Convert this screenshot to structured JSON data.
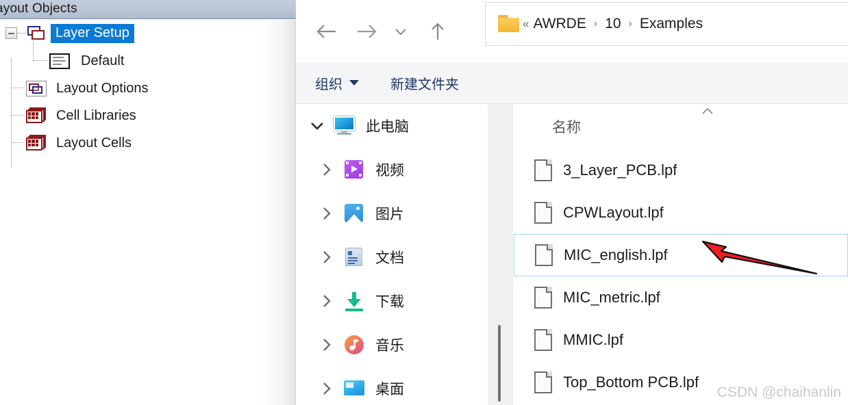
{
  "left_panel": {
    "title": "ayout Objects",
    "tree": [
      {
        "label": "Layer Setup",
        "icon": "layer-setup-icon",
        "selected": true,
        "level": 0,
        "expander": "collapse"
      },
      {
        "label": "Default",
        "icon": "default-layer-icon",
        "selected": false,
        "level": 1
      },
      {
        "label": "Layout Options",
        "icon": "layout-options-icon",
        "selected": false,
        "level": 0
      },
      {
        "label": "Cell Libraries",
        "icon": "cell-libraries-icon",
        "selected": false,
        "level": 0
      },
      {
        "label": "Layout Cells",
        "icon": "layout-cells-icon",
        "selected": false,
        "level": 0
      }
    ],
    "colors": {
      "titlebar": "#b9c6d6",
      "selection": "#0b7ad4",
      "icon_red": "#8b1a1a",
      "icon_blue": "#1b2a80"
    }
  },
  "explorer": {
    "nav": {
      "back": "←",
      "forward": "→",
      "recent": "⌄",
      "up": "↑"
    },
    "address": {
      "folder_icon": "folder-icon",
      "overflow": "«",
      "crumbs": [
        "AWRDE",
        "10",
        "Examples"
      ],
      "separator": "›"
    },
    "command_bar": {
      "organize": "组织",
      "new_folder": "新建文件夹"
    },
    "nav_pane": [
      {
        "label": "此电脑",
        "icon": "this-pc-icon",
        "expanded": true,
        "level": 0
      },
      {
        "label": "视频",
        "icon": "videos-icon",
        "expanded": false,
        "level": 1
      },
      {
        "label": "图片",
        "icon": "pictures-icon",
        "expanded": false,
        "level": 1
      },
      {
        "label": "文档",
        "icon": "documents-icon",
        "expanded": false,
        "level": 1
      },
      {
        "label": "下载",
        "icon": "downloads-icon",
        "expanded": false,
        "level": 1
      },
      {
        "label": "音乐",
        "icon": "music-icon",
        "expanded": false,
        "level": 1
      },
      {
        "label": "桌面",
        "icon": "desktop-icon",
        "expanded": false,
        "level": 1
      }
    ],
    "file_list": {
      "column_header": "名称",
      "sort": "ascending",
      "files": [
        {
          "name": "3_Layer_PCB.lpf",
          "selected": false
        },
        {
          "name": "CPWLayout.lpf",
          "selected": false
        },
        {
          "name": "MIC_english.lpf",
          "selected": true
        },
        {
          "name": "MIC_metric.lpf",
          "selected": false
        },
        {
          "name": "MMIC.lpf",
          "selected": false
        },
        {
          "name": "Top_Bottom PCB.lpf",
          "selected": false
        }
      ]
    },
    "selection_border_color": "#a5d4f2"
  },
  "annotation": {
    "arrow_color": "#ee1c25",
    "target": "MIC_english.lpf"
  },
  "watermark": "CSDN @chaihanlin"
}
